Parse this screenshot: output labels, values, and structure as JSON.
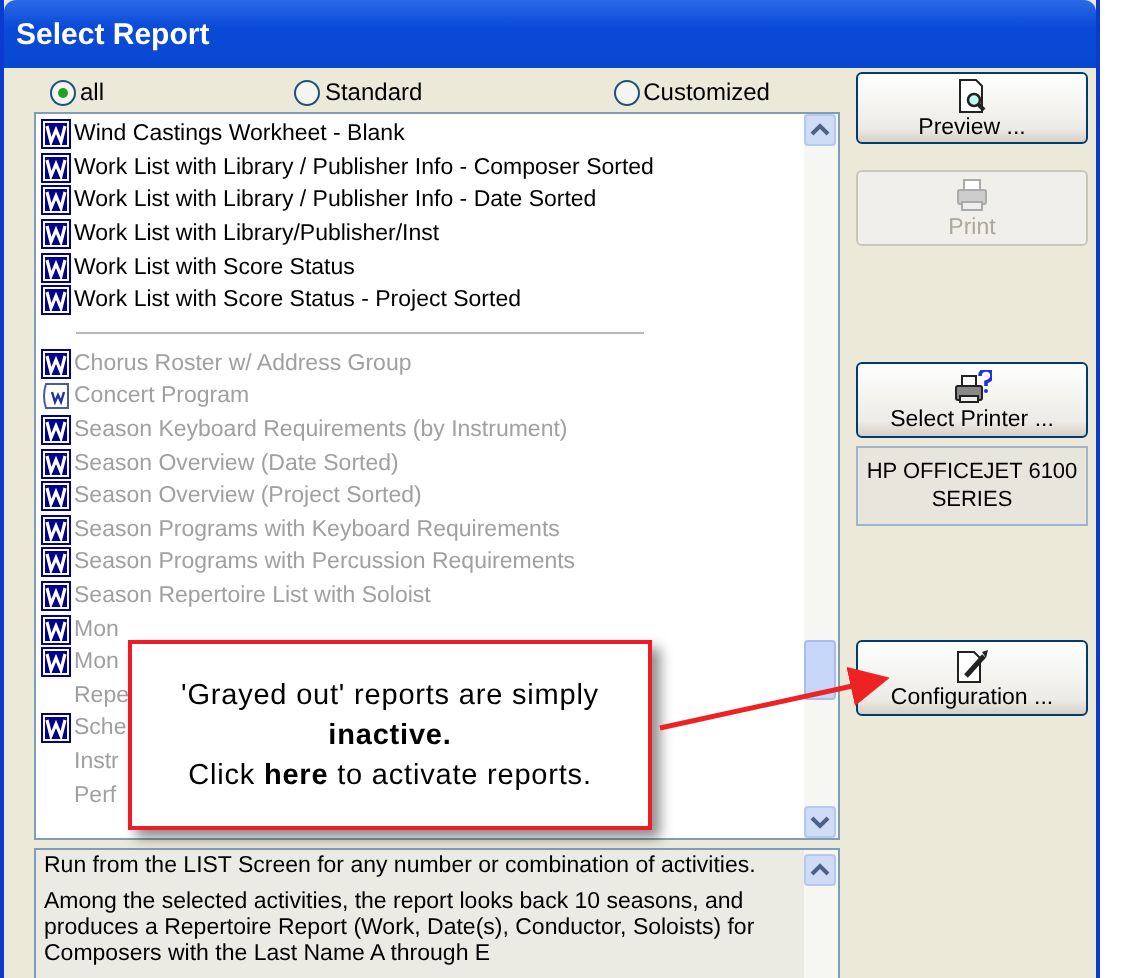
{
  "window": {
    "title": "Select Report"
  },
  "filters": [
    {
      "label": "all",
      "selected": true
    },
    {
      "label": "Standard",
      "selected": false
    },
    {
      "label": "Customized",
      "selected": false
    }
  ],
  "reports": [
    {
      "label": "Wind Castings Workheet - Blank",
      "active": true,
      "kind": "word"
    },
    {
      "label": "Work List with Library / Publisher Info - Composer Sorted",
      "active": true,
      "kind": "word"
    },
    {
      "label": "Work List with Library / Publisher Info - Date Sorted",
      "active": true,
      "kind": "word"
    },
    {
      "label": "Work List with Library/Publisher/Inst",
      "active": true,
      "kind": "word"
    },
    {
      "label": "Work List with Score Status",
      "active": true,
      "kind": "word"
    },
    {
      "label": "Work List with Score Status - Project Sorted",
      "active": true,
      "kind": "word"
    },
    {
      "kind": "separator"
    },
    {
      "label": "Chorus Roster w/ Address Group",
      "active": false,
      "kind": "word"
    },
    {
      "label": "Concert Program",
      "active": false,
      "kind": "scroll"
    },
    {
      "label": "Season Keyboard Requirements (by Instrument)",
      "active": false,
      "kind": "word"
    },
    {
      "label": "Season Overview (Date Sorted)",
      "active": false,
      "kind": "word"
    },
    {
      "label": "Season Overview (Project Sorted)",
      "active": false,
      "kind": "word"
    },
    {
      "label": "Season Programs with Keyboard Requirements",
      "active": false,
      "kind": "word"
    },
    {
      "label": "Season Programs with Percussion Requirements",
      "active": false,
      "kind": "word"
    },
    {
      "label": "Season Repertoire List with Soloist",
      "active": false,
      "kind": "word"
    },
    {
      "label": "Mon",
      "active": false,
      "kind": "word"
    },
    {
      "label": "Mon",
      "active": false,
      "kind": "word"
    },
    {
      "label": "Repe",
      "active": false,
      "kind": "plain"
    },
    {
      "label": "Sche",
      "active": false,
      "kind": "word"
    },
    {
      "label": "Instr",
      "active": false,
      "kind": "plain"
    },
    {
      "label": "Perf",
      "active": false,
      "kind": "plain"
    }
  ],
  "description": [
    "Run from the LIST Screen for any number or combination of activities.",
    "Among the selected activities, the report looks back 10 seasons, and produces a Repertoire Report (Work, Date(s), Conductor, Soloists) for Composers with the Last Name A through E"
  ],
  "buttons": [
    {
      "label": "Preview ...",
      "kind": "preview",
      "disabled": false
    },
    {
      "label": "Print",
      "kind": "print",
      "disabled": true
    },
    {
      "label": "Select Printer ...",
      "kind": "printer",
      "disabled": false
    },
    {
      "label": "Configuration ...",
      "kind": "config",
      "disabled": false
    }
  ],
  "printer": "HP OFFICEJET 6100 SERIES",
  "callout": {
    "lines": [
      "'Grayed out' reports are simply **inactive.**",
      "Click **here** to activate reports."
    ]
  }
}
